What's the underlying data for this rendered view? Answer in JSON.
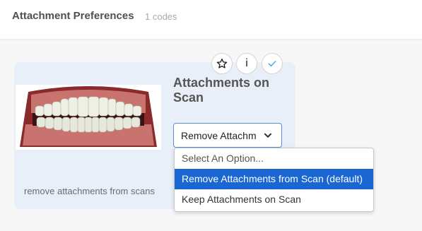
{
  "header": {
    "title": "Attachment Preferences",
    "count": "1 codes"
  },
  "card": {
    "option_title": "Attachments on Scan",
    "caption": "remove attachments from scans",
    "image": "teeth-with-gums"
  },
  "actions": [
    {
      "icon": "star-icon"
    },
    {
      "icon": "info-icon",
      "label": "i"
    },
    {
      "icon": "check-icon"
    }
  ],
  "select": {
    "value": "Remove Attachments from Scan (default)",
    "options": [
      "Select An Option...",
      "Remove Attachments from Scan (default)",
      "Keep Attachments on Scan"
    ],
    "selected_index": 1
  },
  "colors": {
    "accent": "#1a66d2",
    "card_bg": "#e8eff9",
    "check": "#4aa8e0"
  }
}
